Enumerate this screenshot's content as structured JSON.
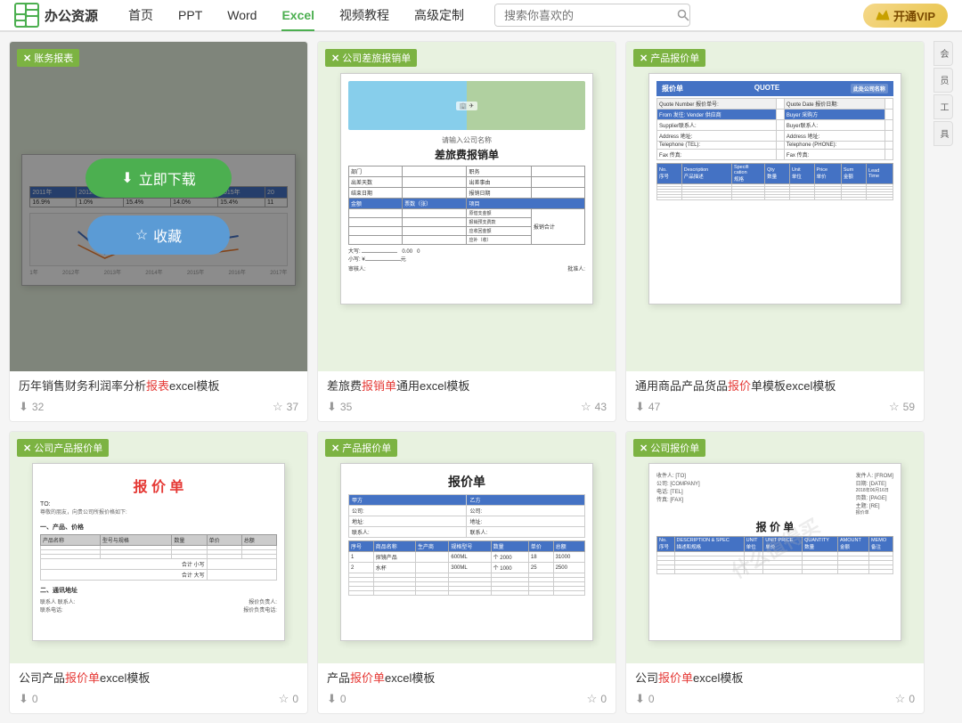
{
  "header": {
    "logo_text": "办公资源",
    "nav": [
      {
        "label": "首页",
        "active": false
      },
      {
        "label": "PPT",
        "active": false
      },
      {
        "label": "Word",
        "active": false
      },
      {
        "label": "Excel",
        "active": true
      },
      {
        "label": "视频教程",
        "active": false
      },
      {
        "label": "高级定制",
        "active": false
      }
    ],
    "search_placeholder": "搜索你喜欢的",
    "vip_label": "开通VIP"
  },
  "cards": [
    {
      "badge": "Excel",
      "section_title": "账务报表",
      "title": "历年销售财务利润率分析报表excel模板",
      "highlight_words": [
        "报表"
      ],
      "downloads": 32,
      "favorites": 37,
      "overlay": true,
      "btn_download": "立即下载",
      "btn_collect": "收藏"
    },
    {
      "badge": "Excel",
      "section_title": "公司差旅报销单",
      "title": "差旅费报销单通用excel模板",
      "highlight_words": [
        "报销单"
      ],
      "downloads": 35,
      "favorites": 43,
      "overlay": false
    },
    {
      "badge": "Excel",
      "section_title": "产品报价单",
      "title": "通用商品产品货品报价单模板excel模板",
      "highlight_words": [
        "报价"
      ],
      "downloads": 47,
      "favorites": 59,
      "overlay": false
    },
    {
      "badge": "Excel",
      "section_title": "公司产品报价单",
      "title": "公司产品报价单excel模板",
      "highlight_words": [
        "报价单"
      ],
      "downloads": 0,
      "favorites": 0,
      "overlay": false
    },
    {
      "badge": "Excel",
      "section_title": "产品报价单",
      "title": "产品报价单excel模板",
      "highlight_words": [
        "报价单"
      ],
      "downloads": 0,
      "favorites": 0,
      "overlay": false
    },
    {
      "badge": "Excel",
      "section_title": "公司报价单",
      "title": "公司报价单excel模板",
      "highlight_words": [
        "报价单"
      ],
      "downloads": 0,
      "favorites": 0,
      "overlay": false
    }
  ],
  "side_panel": [
    {
      "label": "会"
    },
    {
      "label": "员"
    },
    {
      "label": "工"
    },
    {
      "label": "具"
    }
  ],
  "watermark": "什么值得买"
}
